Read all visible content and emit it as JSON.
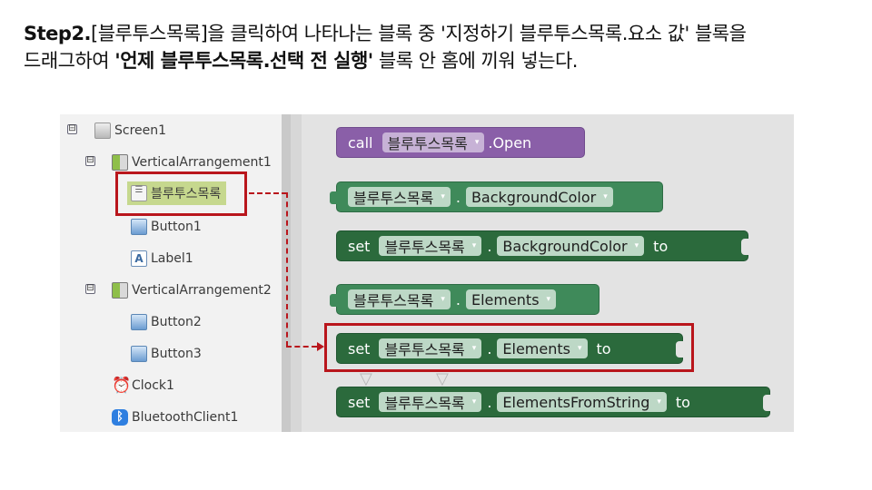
{
  "instruction": {
    "step": "Step2.",
    "line1_rest": "[블루투스목록]을 클릭하여 나타나는 블록 중 '지정하기 블루투스목록.요소 값' 블록을",
    "line2_pre": "드래그하여 ",
    "line2_bold": "'언제 블루투스목록.선택 전 실행'",
    "line2_post": " 블록 안 홈에 끼워 넣는다."
  },
  "tree": {
    "toggle_glyph": "⊟",
    "items": [
      {
        "label": "Screen1",
        "icon": "screen-icon"
      },
      {
        "label": "VerticalArrangement1",
        "icon": "vertical-arrangement-icon"
      },
      {
        "label": "블루투스목록",
        "icon": "listpicker-icon"
      },
      {
        "label": "Button1",
        "icon": "button-icon"
      },
      {
        "label": "Label1",
        "icon": "label-icon"
      },
      {
        "label": "VerticalArrangement2",
        "icon": "vertical-arrangement-icon"
      },
      {
        "label": "Button2",
        "icon": "button-icon"
      },
      {
        "label": "Button3",
        "icon": "button-icon"
      },
      {
        "label": "Clock1",
        "icon": "clock-icon"
      },
      {
        "label": "BluetoothClient1",
        "icon": "bluetooth-icon"
      }
    ]
  },
  "blocks": {
    "component": "블루투스목록",
    "dropdown_arrow": "▾",
    "call_block": {
      "keyword": "call",
      "method": ".Open"
    },
    "getter_bg": {
      "property": "BackgroundColor"
    },
    "setter_bg": {
      "keyword": "set",
      "property": "BackgroundColor",
      "to": "to"
    },
    "getter_el": {
      "property": "Elements"
    },
    "setter_el": {
      "keyword": "set",
      "property": "Elements",
      "to": "to"
    },
    "setter_efs": {
      "keyword": "set",
      "property": "ElementsFromString",
      "to": "to"
    },
    "dot": "."
  },
  "colors": {
    "highlight": "#b9161c",
    "procedure_block": "#8a5fa8",
    "component_block": "#3f8a5a",
    "selected_item": "#c6d88e"
  }
}
